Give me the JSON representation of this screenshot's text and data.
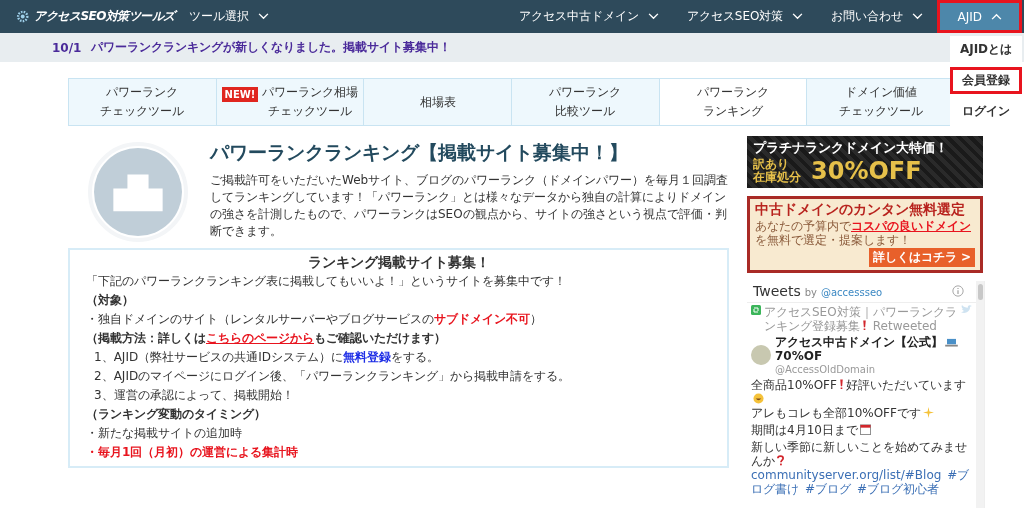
{
  "header": {
    "logo": "アクセスSEO対策ツールズ",
    "tool_menu": {
      "label": "ツール選択",
      "expanded": false,
      "highlighted": false
    },
    "nav": [
      {
        "label": "アクセス中古ドメイン",
        "expanded": false,
        "highlighted": false
      },
      {
        "label": "アクセスSEO対策",
        "expanded": false,
        "highlighted": false
      },
      {
        "label": "お問い合わせ",
        "expanded": false,
        "highlighted": false
      },
      {
        "label": "AJID",
        "expanded": true,
        "highlighted": true
      }
    ]
  },
  "dropdown": [
    {
      "label": "AJIDとは",
      "highlighted": false
    },
    {
      "label": "会員登録",
      "highlighted": true
    },
    {
      "label": "ログイン",
      "highlighted": false
    }
  ],
  "notice": {
    "date": "10/1",
    "text": "パワーランクランキングが新しくなりました。掲載サイト募集中！"
  },
  "tools": [
    {
      "lines": [
        "パワーランク",
        "チェックツール"
      ],
      "selected": false
    },
    {
      "lines": [
        "パワーランク相場",
        "チェックツール"
      ],
      "badge": "NEW!",
      "selected": false
    },
    {
      "lines": [
        "相場表"
      ],
      "selected": false
    },
    {
      "lines": [
        "パワーランク",
        "比較ツール"
      ],
      "selected": false
    },
    {
      "lines": [
        "パワーランク",
        "ランキング"
      ],
      "selected": true
    },
    {
      "lines": [
        "ドメイン価値",
        "チェックツール"
      ],
      "selected": false
    }
  ],
  "intro": {
    "title": "パワーランクランキング【掲載サイト募集中！】",
    "text": "ご掲載許可をいただいたWebサイト、ブログのパワーランク（ドメインパワー）を毎月１回調査してランキングしています！「パワーランク」とは様々なデータから独自の計算によりドメインの強さを計測したもので、パワーランクはSEOの観点から、サイトの強さという視点で評価・判断できます。"
  },
  "recruit": {
    "title": "ランキング掲載サイト募集！",
    "lines": [
      {
        "kind": "plain",
        "parts": [
          {
            "kind": "text",
            "text": "「下記のパワーランクランキング表に掲載してもいいよ！」というサイトを募集中です！"
          }
        ]
      },
      {
        "kind": "heading",
        "parts": [
          {
            "kind": "text",
            "text": "（対象）"
          }
        ]
      },
      {
        "kind": "plain",
        "parts": [
          {
            "kind": "text",
            "text": "・独自ドメインのサイト（レンタルサーバーやブログサービスの"
          },
          {
            "kind": "red",
            "text": "サブドメイン不可"
          },
          {
            "kind": "text",
            "text": "）"
          }
        ]
      },
      {
        "kind": "heading",
        "parts": [
          {
            "kind": "text",
            "text": "（掲載方法：詳しくは"
          },
          {
            "kind": "red-link",
            "text": "こちらのページから"
          },
          {
            "kind": "text",
            "text": "もご確認いただけます）"
          }
        ]
      },
      {
        "kind": "step",
        "parts": [
          {
            "kind": "text",
            "text": "1、AJID（弊社サービスの共通IDシステム）に"
          },
          {
            "kind": "blue-link",
            "text": "無料登録"
          },
          {
            "kind": "text",
            "text": "をする。"
          }
        ]
      },
      {
        "kind": "step",
        "parts": [
          {
            "kind": "text",
            "text": "2、AJIDのマイページにログイン後、「パワーランクランキング」から掲載申請をする。"
          }
        ]
      },
      {
        "kind": "step",
        "parts": [
          {
            "kind": "text",
            "text": "3、運営の承認によって、掲載開始！"
          }
        ]
      },
      {
        "kind": "heading",
        "parts": [
          {
            "kind": "text",
            "text": "（ランキング変動のタイミング）"
          }
        ]
      },
      {
        "kind": "plain",
        "parts": [
          {
            "kind": "text",
            "text": "・新たな掲載サイトの追加時"
          }
        ]
      },
      {
        "kind": "plain",
        "parts": [
          {
            "kind": "red",
            "text": "・毎月1回（月初）の運営による集計時"
          }
        ]
      }
    ]
  },
  "banners": [
    {
      "kind": "sale",
      "headline": "プラチナランクドメイン大特価！",
      "sub": [
        "訳あり",
        "在庫処分"
      ],
      "big": "30%OFF"
    },
    {
      "kind": "select",
      "headline": "中古ドメインのカンタン無料選定",
      "parts": [
        {
          "kind": "text",
          "text": "あなたの予算内で"
        },
        {
          "kind": "red-link",
          "text": "コスパの良いドメイン"
        },
        {
          "kind": "text",
          "text": "を無料で選定・提案します！"
        }
      ],
      "button": "詳しくはコチラ >"
    }
  ],
  "tweets": {
    "title": "Tweets",
    "by": "by",
    "handle": "@accessseo",
    "retweet": "アクセスSEO対策｜パワーランクランキング登録募集",
    "retweeted": "Retweeted",
    "author": "アクセス中古ドメイン【公式】",
    "author_suffix": "70%OF",
    "author_handle": "@AccessOldDomain",
    "paragraphs": [
      [
        {
          "kind": "text",
          "text": "全商品10%OFF"
        },
        {
          "kind": "alert"
        },
        {
          "kind": "text",
          "text": "好評いただいています"
        },
        {
          "kind": "smile"
        },
        {
          "kind": "break"
        },
        {
          "kind": "text",
          "text": "アレもコレも全部10%OFFです"
        },
        {
          "kind": "sparkle"
        }
      ],
      [
        {
          "kind": "text",
          "text": "期間は4月10日まで"
        },
        {
          "kind": "calendar"
        }
      ],
      [
        {
          "kind": "text",
          "text": "新しい季節に新しいことを始めてみませんか"
        },
        {
          "kind": "question"
        },
        {
          "kind": "break"
        },
        {
          "kind": "link",
          "text": "communityserver.org/list/#Blog"
        },
        {
          "kind": "link",
          "text": "#ブログ書け"
        },
        {
          "kind": "link",
          "text": "#ブログ"
        },
        {
          "kind": "link",
          "text": "#ブログ初心者"
        }
      ]
    ]
  }
}
